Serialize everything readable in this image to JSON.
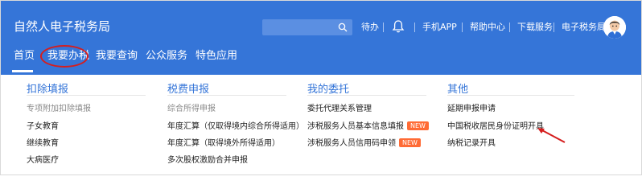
{
  "header": {
    "title": "自然人电子税务局",
    "search": {
      "placeholder": ""
    },
    "pending": "待办",
    "links": [
      "手机APP",
      "帮助中心",
      "下载服务",
      "电子税务局"
    ]
  },
  "nav": {
    "items": [
      "首页",
      "我要办税",
      "我要查询",
      "公众服务",
      "特色应用"
    ],
    "active": "首页",
    "highlighted": "我要办税"
  },
  "menu": {
    "columns": [
      {
        "heading": "扣除填报",
        "items": [
          {
            "label": "专项附加扣除填报",
            "muted": true
          },
          {
            "label": "子女教育"
          },
          {
            "label": "继续教育"
          },
          {
            "label": "大病医疗"
          }
        ]
      },
      {
        "heading": "税费申报",
        "items": [
          {
            "label": "综合所得申报",
            "muted": true
          },
          {
            "label": "年度汇算（仅取得境内综合所得适用）"
          },
          {
            "label": "年度汇算（取得境外所得适用）"
          },
          {
            "label": "多次股权激励合并申报"
          }
        ]
      },
      {
        "heading": "我的委托",
        "items": [
          {
            "label": "委托代理关系管理"
          },
          {
            "label": "涉税服务人员基本信息填报",
            "badge": "NEW"
          },
          {
            "label": "涉税服务人员信用码申领",
            "badge": "NEW"
          }
        ]
      },
      {
        "heading": "其他",
        "items": [
          {
            "label": "延期申报申请"
          },
          {
            "label": "中国税收居民身份证明开具"
          },
          {
            "label": "纳税记录开具"
          }
        ]
      }
    ]
  },
  "colors": {
    "brand": "#3575d8",
    "badge": "#ff6b35",
    "annotation": "#d51e1e"
  }
}
